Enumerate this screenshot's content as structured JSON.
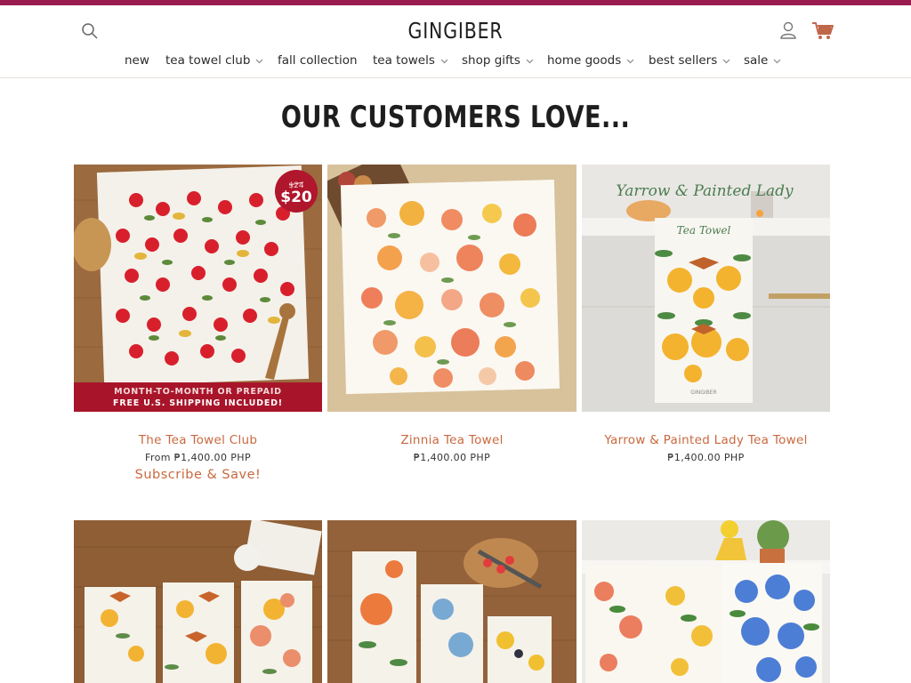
{
  "brand": {
    "logo_text": "GINGIBER",
    "accent_color": "#9a1b4d",
    "link_color": "#c8683e"
  },
  "header": {
    "icons": {
      "search": "search-icon",
      "account": "account-icon",
      "cart": "cart-icon"
    }
  },
  "nav": {
    "items": [
      {
        "label": "new"
      },
      {
        "label": "tea towel club"
      },
      {
        "label": "fall collection"
      },
      {
        "label": "tea towels"
      },
      {
        "label": "shop gifts"
      },
      {
        "label": "home goods"
      },
      {
        "label": "best sellers"
      },
      {
        "label": "sale"
      }
    ]
  },
  "section": {
    "title": "OUR CUSTOMERS LOVE..."
  },
  "products": [
    {
      "title": "The Tea Towel Club",
      "price": "From ₱1,400.00 PHP",
      "cta": "Subscribe & Save!",
      "badge_old": "$24",
      "badge_new": "$20",
      "banner_line1": "MONTH-TO-MONTH OR PREPAID",
      "banner_line2": "FREE U.S. SHIPPING INCLUDED!"
    },
    {
      "title": "Zinnia Tea Towel",
      "price": "₱1,400.00 PHP"
    },
    {
      "title": "Yarrow & Painted Lady Tea Towel",
      "price": "₱1,400.00 PHP",
      "overlay_text": "Yarrow & Painted Lady",
      "towel_text": "Tea Towel",
      "tag_text": "GINGIBER"
    },
    {
      "title": ""
    },
    {
      "title": ""
    },
    {
      "title": ""
    }
  ]
}
